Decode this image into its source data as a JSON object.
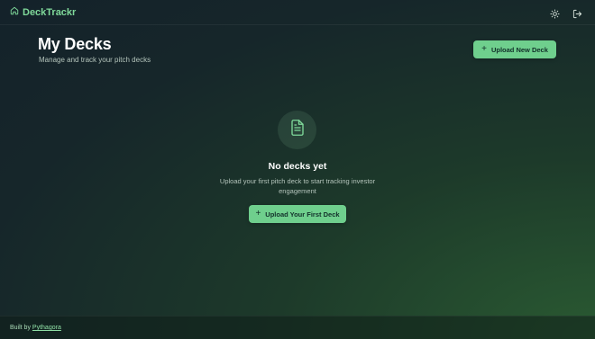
{
  "app": {
    "brand_name": "DeckTrackr",
    "brand_icon": "home-icon",
    "accent_color": "#7fd99a"
  },
  "header": {
    "theme_icon": "sun-icon",
    "logout_icon": "logout-icon"
  },
  "page": {
    "title": "My Decks",
    "subtitle": "Manage and track your pitch decks",
    "upload_button_label": "Upload New Deck"
  },
  "empty_state": {
    "icon": "document-icon",
    "title": "No decks yet",
    "description": "Upload your first pitch deck to start tracking investor engagement",
    "button_label": "Upload Your First Deck"
  },
  "footer": {
    "prefix": "Built by",
    "link_label": "Pythagora"
  }
}
